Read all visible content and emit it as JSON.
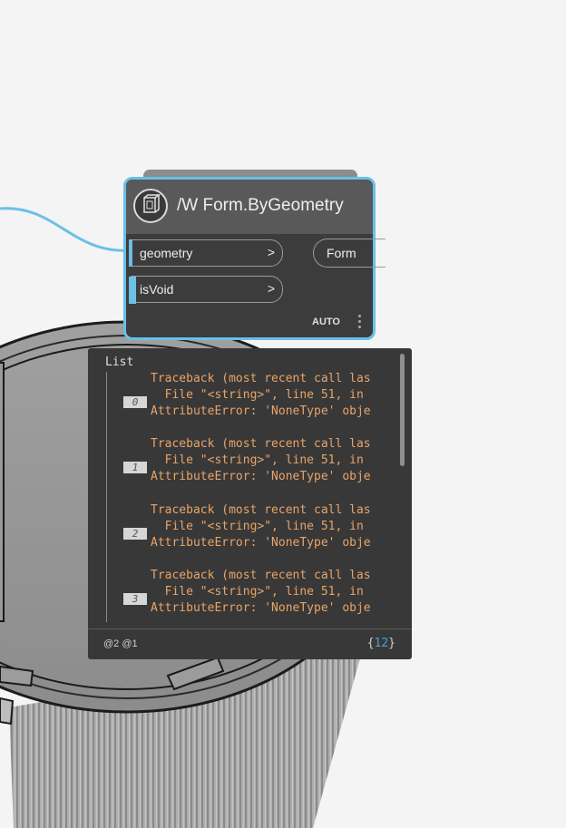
{
  "node": {
    "name_prefix": "/W",
    "title": "Form.ByGeometry",
    "inputs": [
      {
        "label": "geometry",
        "arrow": ">"
      },
      {
        "label": "isVoid",
        "arrow": ">"
      }
    ],
    "output": {
      "label": "Form"
    },
    "lacing": "AUTO",
    "icon": "form-geometry-icon"
  },
  "preview": {
    "header": "List",
    "items": [
      {
        "index": "0",
        "lines": [
          "Traceback (most recent call las",
          "  File \"<string>\", line 51, in",
          "AttributeError: 'NoneType' obje"
        ]
      },
      {
        "index": "1",
        "lines": [
          "Traceback (most recent call las",
          "  File \"<string>\", line 51, in",
          "AttributeError: 'NoneType' obje"
        ]
      },
      {
        "index": "2",
        "lines": [
          "Traceback (most recent call las",
          "  File \"<string>\", line 51, in",
          "AttributeError: 'NoneType' obje"
        ]
      },
      {
        "index": "3",
        "lines": [
          "Traceback (most recent call las",
          "  File \"<string>\", line 51, in",
          "AttributeError: 'NoneType' obje"
        ]
      }
    ],
    "levels": "@2 @1",
    "count_open": "{",
    "count": "12",
    "count_close": "}"
  },
  "colors": {
    "wire": "#6ac0e7",
    "node_border": "#6ac0e7",
    "error_text": "#e8a468",
    "count": "#44a6d6"
  }
}
